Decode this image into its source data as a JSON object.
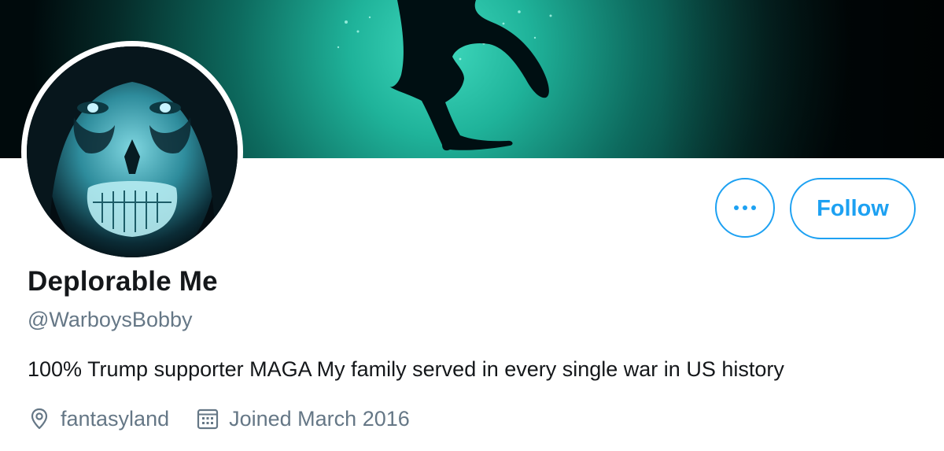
{
  "profile": {
    "display_name": "Deplorable Me",
    "handle": "@WarboysBobby",
    "bio": "100% Trump supporter MAGA My family served in every single war in US history",
    "location": "fantasyland",
    "joined": "Joined March 2016"
  },
  "actions": {
    "follow_label": "Follow",
    "more_icon": "more-dots-icon"
  },
  "icons": {
    "location": "location-pin-icon",
    "joined": "calendar-icon"
  },
  "colors": {
    "accent": "#1da1f2",
    "primary_text": "#14171a",
    "secondary_text": "#657786",
    "banner_glow": "#1fb39a"
  }
}
